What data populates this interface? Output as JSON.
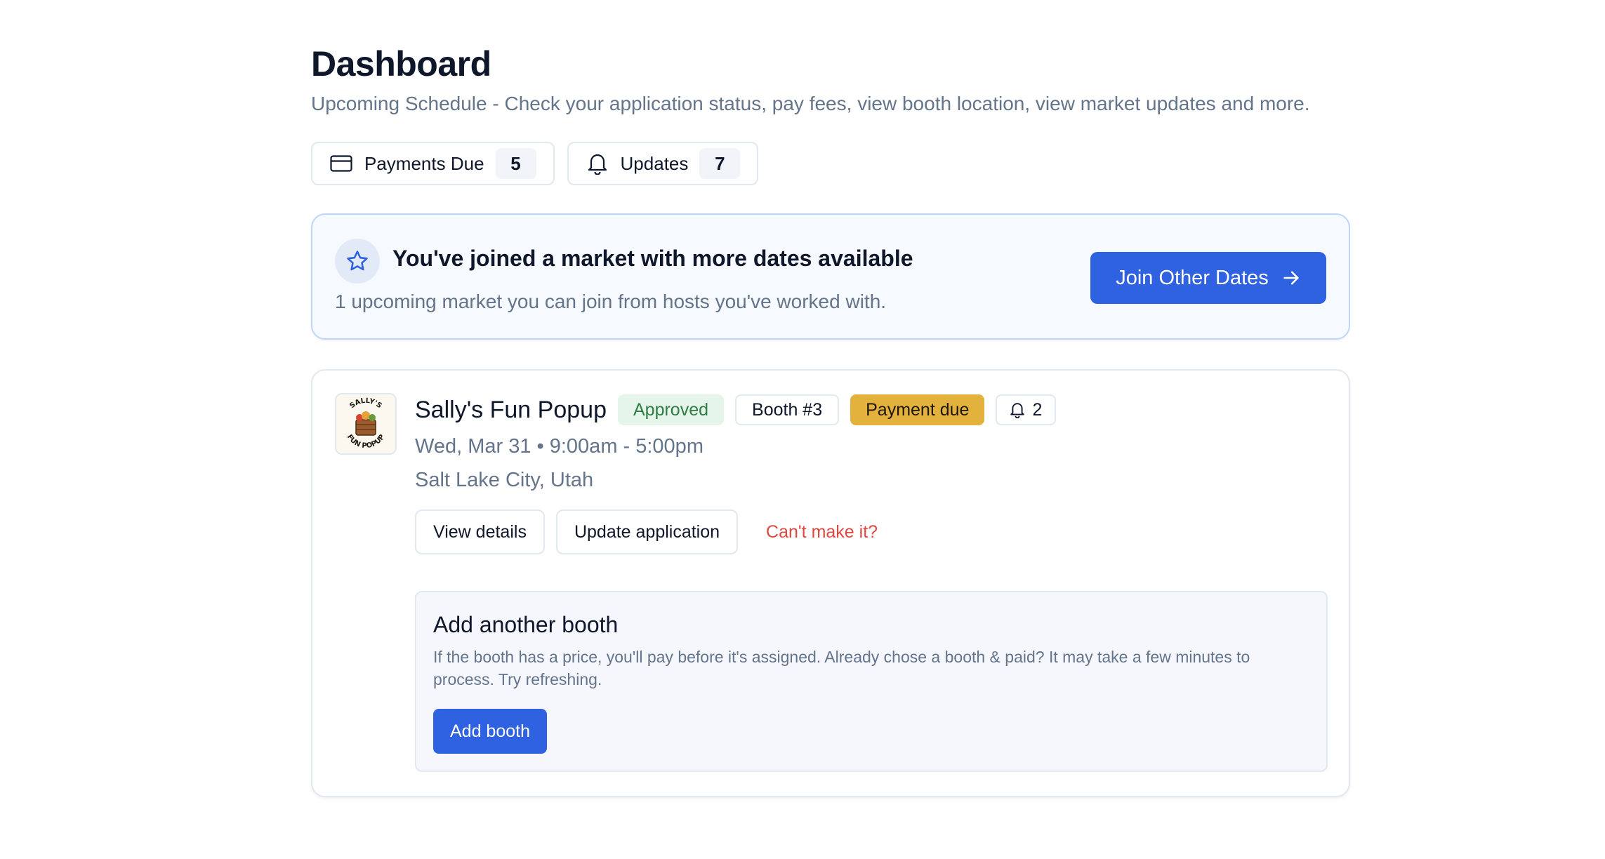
{
  "page": {
    "title": "Dashboard",
    "subtitle": "Upcoming Schedule - Check your application status, pay fees, view booth location, view market updates and more."
  },
  "chips": {
    "payments": {
      "label": "Payments Due",
      "count": "5",
      "icon": "credit-card-icon"
    },
    "updates": {
      "label": "Updates",
      "count": "7",
      "icon": "bell-icon"
    }
  },
  "banner": {
    "icon": "star-icon",
    "title": "You've joined a market with more dates available",
    "text": "1 upcoming market you can join from hosts you've worked with.",
    "button_label": "Join Other Dates"
  },
  "event": {
    "name": "Sally's Fun Popup",
    "logo_text": "SALLY'S FUN POPUP",
    "status": "Approved",
    "booth": "Booth #3",
    "payment": "Payment due",
    "notifications": "2",
    "when": "Wed, Mar 31 • 9:00am - 5:00pm",
    "where": "Salt Lake City, Utah",
    "actions": {
      "view_details": "View details",
      "update_application": "Update application",
      "cant_make_it": "Can't make it?"
    },
    "add_booth": {
      "title": "Add another booth",
      "text": "If the booth has a price, you'll pay before it's assigned. Already chose a booth & paid? It may take a few minutes to process. Try refreshing.",
      "button_label": "Add booth"
    }
  },
  "colors": {
    "primary": "#2f62e0",
    "approved_bg": "#e6f5ea",
    "approved_text": "#2f7d45",
    "payment_bg": "#e3b23c",
    "danger": "#e0483f",
    "muted_text": "#64748b"
  }
}
